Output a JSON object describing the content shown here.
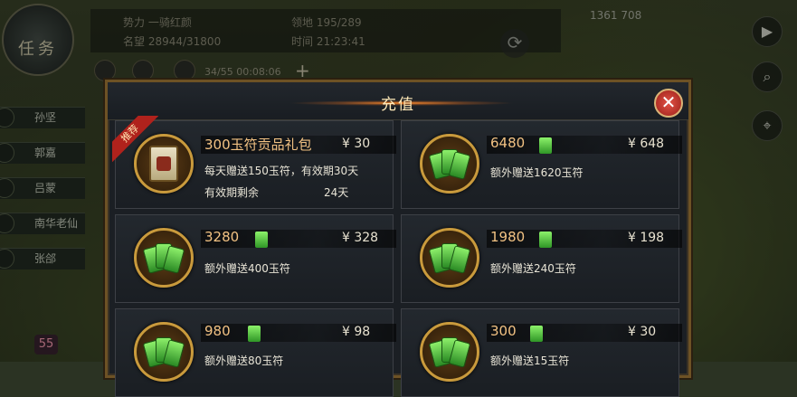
{
  "hud": {
    "task_label": "任务",
    "power_label": "势力 一骑红颜",
    "fame_label": "名望 28944/31800",
    "territory_label": "领地 195/289",
    "time_label": "时间 21:23:41",
    "timer": "34/55 00:08:06",
    "plus": "+",
    "coords": "1361 708",
    "refresh_icon": "⟳"
  },
  "side_buttons": [
    {
      "icon": "play-icon",
      "glyph": "▶"
    },
    {
      "icon": "search-icon",
      "glyph": "⌕"
    },
    {
      "icon": "location-icon",
      "glyph": "⌖"
    }
  ],
  "generals": [
    "孙坚",
    "郭嘉",
    "吕蒙",
    "南华老仙",
    "张郃"
  ],
  "badge": "55",
  "dialog": {
    "title": "充值",
    "close_icon": "✕",
    "ribbon": "推荐",
    "packs": [
      {
        "name": "300玉符贡品礼包",
        "price": "¥ 30",
        "desc": "每天赠送150玉符，有效期30天",
        "remain_label": "有效期剩余",
        "remain_days": "24天",
        "type": "gift"
      },
      {
        "name": "6480",
        "price": "¥ 648",
        "desc": "额外赠送1620玉符",
        "type": "jade"
      },
      {
        "name": "3280",
        "price": "¥ 328",
        "desc": "额外赠送400玉符",
        "type": "jade"
      },
      {
        "name": "1980",
        "price": "¥ 198",
        "desc": "额外赠送240玉符",
        "type": "jade"
      },
      {
        "name": "980",
        "price": "¥ 98",
        "desc": "额外赠送80玉符",
        "type": "jade"
      },
      {
        "name": "300",
        "price": "¥ 30",
        "desc": "额外赠送15玉符",
        "type": "jade"
      }
    ]
  },
  "colors": {
    "accent": "#f2c283",
    "frame": "#6d5225",
    "close": "#c9342a",
    "jade": "#5fd046"
  }
}
